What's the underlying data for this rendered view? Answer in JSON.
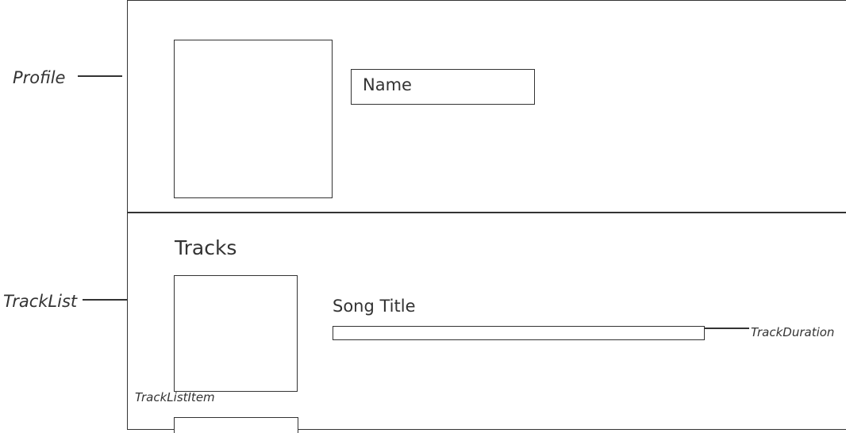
{
  "annotations": {
    "profile": "Profile",
    "track_list": "TrackList",
    "track_duration": "TrackDuration",
    "track_list_item": "TrackListItem"
  },
  "profile": {
    "name_label": "Name"
  },
  "tracks": {
    "heading": "Tracks",
    "song_title": "Song Title"
  }
}
